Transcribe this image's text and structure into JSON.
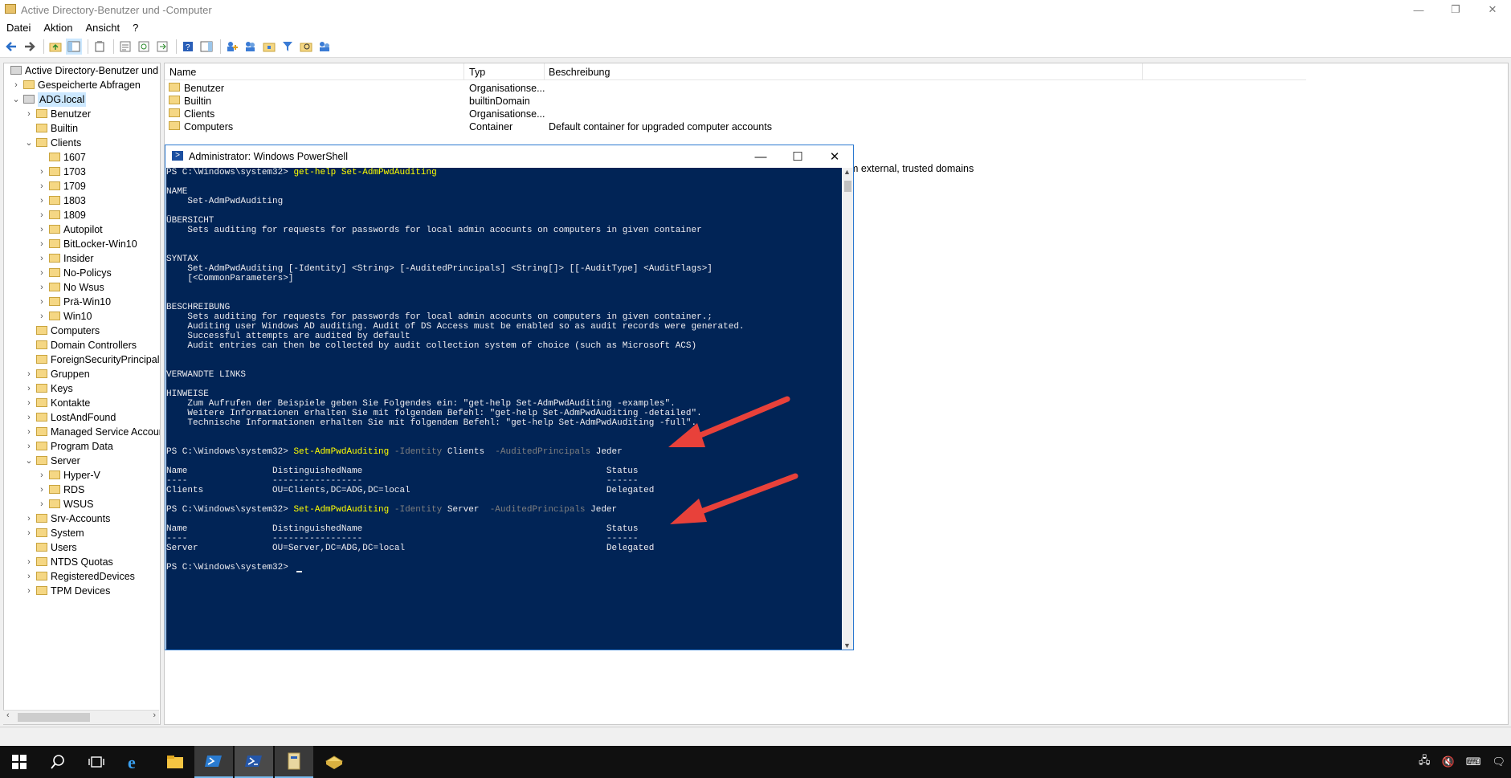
{
  "window": {
    "title": "Active Directory-Benutzer und -Computer",
    "controls": [
      "—",
      "❐",
      "✕"
    ]
  },
  "menu": [
    "Datei",
    "Aktion",
    "Ansicht",
    "?"
  ],
  "tree": {
    "items": [
      {
        "label": "Active Directory-Benutzer und -",
        "level": 0,
        "expander": ""
      },
      {
        "label": "Gespeicherte Abfragen",
        "level": 1,
        "expander": "›"
      },
      {
        "label": "ADG.local",
        "level": 1,
        "expander": "⌄"
      },
      {
        "label": "Benutzer",
        "level": 2,
        "expander": "›"
      },
      {
        "label": "Builtin",
        "level": 2,
        "expander": ""
      },
      {
        "label": "Clients",
        "level": 2,
        "expander": "⌄"
      },
      {
        "label": "1607",
        "level": 3,
        "expander": ""
      },
      {
        "label": "1703",
        "level": 3,
        "expander": "›"
      },
      {
        "label": "1709",
        "level": 3,
        "expander": "›"
      },
      {
        "label": "1803",
        "level": 3,
        "expander": "›"
      },
      {
        "label": "1809",
        "level": 3,
        "expander": "›"
      },
      {
        "label": "Autopilot",
        "level": 3,
        "expander": "›"
      },
      {
        "label": "BitLocker-Win10",
        "level": 3,
        "expander": "›"
      },
      {
        "label": "Insider",
        "level": 3,
        "expander": "›"
      },
      {
        "label": "No-Policys",
        "level": 3,
        "expander": "›"
      },
      {
        "label": "No Wsus",
        "level": 3,
        "expander": "›"
      },
      {
        "label": "Prä-Win10",
        "level": 3,
        "expander": "›"
      },
      {
        "label": "Win10",
        "level": 3,
        "expander": "›"
      },
      {
        "label": "Computers",
        "level": 2,
        "expander": ""
      },
      {
        "label": "Domain Controllers",
        "level": 2,
        "expander": ""
      },
      {
        "label": "ForeignSecurityPrincipals",
        "level": 2,
        "expander": ""
      },
      {
        "label": "Gruppen",
        "level": 2,
        "expander": "›"
      },
      {
        "label": "Keys",
        "level": 2,
        "expander": "›"
      },
      {
        "label": "Kontakte",
        "level": 2,
        "expander": "›"
      },
      {
        "label": "LostAndFound",
        "level": 2,
        "expander": "›"
      },
      {
        "label": "Managed Service Accour",
        "level": 2,
        "expander": "›"
      },
      {
        "label": "Program Data",
        "level": 2,
        "expander": "›"
      },
      {
        "label": "Server",
        "level": 2,
        "expander": "⌄"
      },
      {
        "label": "Hyper-V",
        "level": 3,
        "expander": "›"
      },
      {
        "label": "RDS",
        "level": 3,
        "expander": "›"
      },
      {
        "label": "WSUS",
        "level": 3,
        "expander": "›"
      },
      {
        "label": "Srv-Accounts",
        "level": 2,
        "expander": "›"
      },
      {
        "label": "System",
        "level": 2,
        "expander": "›"
      },
      {
        "label": "Users",
        "level": 2,
        "expander": ""
      },
      {
        "label": "NTDS Quotas",
        "level": 2,
        "expander": "›"
      },
      {
        "label": "RegisteredDevices",
        "level": 2,
        "expander": "›"
      },
      {
        "label": "TPM Devices",
        "level": 2,
        "expander": "›"
      }
    ]
  },
  "list": {
    "headers": {
      "name": "Name",
      "type": "Typ",
      "desc": "Beschreibung"
    },
    "rows": [
      {
        "name": "Benutzer",
        "type": "Organisationse...",
        "desc": ""
      },
      {
        "name": "Builtin",
        "type": "builtinDomain",
        "desc": ""
      },
      {
        "name": "Clients",
        "type": "Organisationse...",
        "desc": ""
      },
      {
        "name": "Computers",
        "type": "Container",
        "desc": "Default container for upgraded computer accounts"
      }
    ],
    "partial_text": "om external, trusted domains"
  },
  "powershell": {
    "title": "Administrator: Windows PowerShell",
    "lines": [
      [
        {
          "t": "PS C:\\Windows\\system32> "
        },
        {
          "t": "get-help Set-AdmPwdAuditing",
          "c": "y"
        }
      ],
      [],
      [
        {
          "t": "NAME"
        }
      ],
      [
        {
          "t": "    Set-AdmPwdAuditing"
        }
      ],
      [],
      [
        {
          "t": "ÜBERSICHT"
        }
      ],
      [
        {
          "t": "    Sets auditing for requests for passwords for local admin acocunts on computers in given container"
        }
      ],
      [],
      [],
      [
        {
          "t": "SYNTAX"
        }
      ],
      [
        {
          "t": "    Set-AdmPwdAuditing [-Identity] <String> [-AuditedPrincipals] <String[]> [[-AuditType] <AuditFlags>]"
        }
      ],
      [
        {
          "t": "    [<CommonParameters>]"
        }
      ],
      [],
      [],
      [
        {
          "t": "BESCHREIBUNG"
        }
      ],
      [
        {
          "t": "    Sets auditing for requests for passwords for local admin acocunts on computers in given container.;"
        }
      ],
      [
        {
          "t": "    Auditing user Windows AD auditing. Audit of DS Access must be enabled so as audit records were generated."
        }
      ],
      [
        {
          "t": "    Successful attempts are audited by default"
        }
      ],
      [
        {
          "t": "    Audit entries can then be collected by audit collection system of choice (such as Microsoft ACS)"
        }
      ],
      [],
      [],
      [
        {
          "t": "VERWANDTE LINKS"
        }
      ],
      [],
      [
        {
          "t": "HINWEISE"
        }
      ],
      [
        {
          "t": "    Zum Aufrufen der Beispiele geben Sie Folgendes ein: \"get-help Set-AdmPwdAuditing -examples\"."
        }
      ],
      [
        {
          "t": "    Weitere Informationen erhalten Sie mit folgendem Befehl: \"get-help Set-AdmPwdAuditing -detailed\"."
        }
      ],
      [
        {
          "t": "    Technische Informationen erhalten Sie mit folgendem Befehl: \"get-help Set-AdmPwdAuditing -full\"."
        }
      ],
      [],
      [],
      [
        {
          "t": "PS C:\\Windows\\system32> "
        },
        {
          "t": "Set-AdmPwdAuditing",
          "c": "y"
        },
        {
          "t": " -Identity",
          "c": "g"
        },
        {
          "t": " Clients  "
        },
        {
          "t": "-AuditedPrincipals",
          "c": "g"
        },
        {
          "t": " Jeder"
        }
      ],
      [],
      [
        {
          "t": "Name                DistinguishedName                                              Status"
        }
      ],
      [
        {
          "t": "----                -----------------                                              ------"
        }
      ],
      [
        {
          "t": "Clients             OU=Clients,DC=ADG,DC=local                                     Delegated"
        }
      ],
      [],
      [
        {
          "t": "PS C:\\Windows\\system32> "
        },
        {
          "t": "Set-AdmPwdAuditing",
          "c": "y"
        },
        {
          "t": " -Identity",
          "c": "g"
        },
        {
          "t": " Server  "
        },
        {
          "t": "-AuditedPrincipals",
          "c": "g"
        },
        {
          "t": " Jeder"
        }
      ],
      [],
      [
        {
          "t": "Name                DistinguishedName                                              Status"
        }
      ],
      [
        {
          "t": "----                -----------------                                              ------"
        }
      ],
      [
        {
          "t": "Server              OU=Server,DC=ADG,DC=local                                      Delegated"
        }
      ],
      [],
      [
        {
          "t": "PS C:\\Windows\\system32> "
        },
        {
          "cursor": true
        }
      ]
    ]
  },
  "colors": {
    "console_bg": "#012456",
    "console_fg": "#eeedf0",
    "command": "#ffff00",
    "parameter": "#7f7f7f",
    "annotation_arrow": "#e8413a",
    "taskbar": "#101010"
  },
  "taskbar": {
    "icons": [
      "windows-start-icon",
      "search-icon",
      "task-view-icon",
      "internet-explorer-icon",
      "file-explorer-icon",
      "powershell-ise-icon",
      "powershell-icon",
      "ad-users-computers-icon",
      "server-manager-icon"
    ],
    "tray_icons": [
      "network-icon",
      "volume-muted-icon",
      "keyboard-icon",
      "notification-icon"
    ]
  }
}
